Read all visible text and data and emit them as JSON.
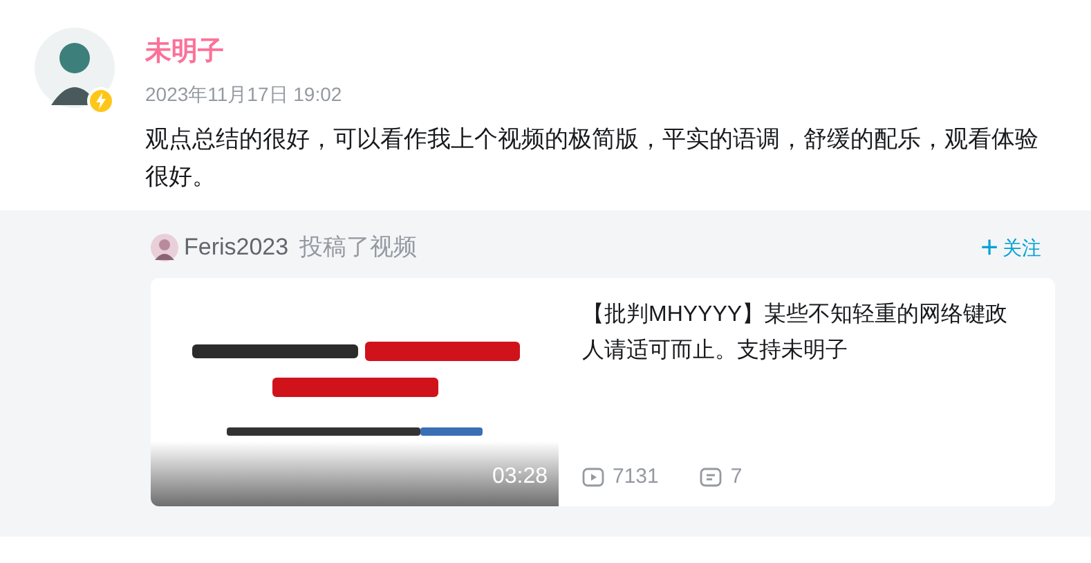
{
  "comment": {
    "author": "未明子",
    "date": "2023年11月17日 19:02",
    "text": "观点总结的很好，可以看作我上个视频的极简版，平实的语调，舒缓的配乐，观看体验很好。"
  },
  "repost": {
    "author": "Feris2023",
    "action": "投稿了视频",
    "follow": {
      "icon": "+",
      "label": "关注"
    },
    "video": {
      "duration": "03:28",
      "title": "【批判MHYYYY】某些不知轻重的网络键政人请适可而止。支持未明子",
      "plays": "7131",
      "comments": "7"
    }
  }
}
